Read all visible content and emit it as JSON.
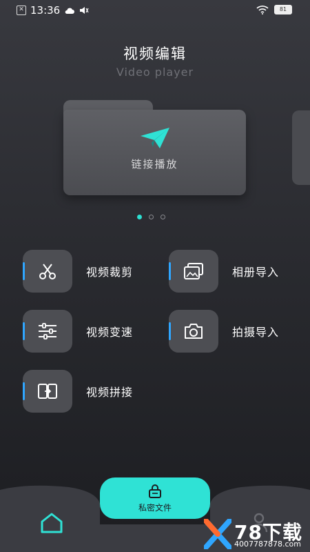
{
  "status_bar": {
    "time": "13:36",
    "battery": "81"
  },
  "header": {
    "title": "视频编辑",
    "subtitle": "Video player"
  },
  "carousel": {
    "card_label": "链接播放",
    "page_count": 3,
    "active_page": 1
  },
  "features": [
    {
      "label": "视频裁剪",
      "icon": "scissors-icon"
    },
    {
      "label": "相册导入",
      "icon": "gallery-icon"
    },
    {
      "label": "视频变速",
      "icon": "sliders-icon"
    },
    {
      "label": "拍摄导入",
      "icon": "camera-icon"
    },
    {
      "label": "视频拼接",
      "icon": "merge-icon"
    }
  ],
  "bottom_bar": {
    "private_label": "私密文件"
  },
  "watermark": {
    "brand": "78下载",
    "domain": "4007787878.com"
  },
  "colors": {
    "accent": "#2fe2d5",
    "indicator": "#2fa6ff",
    "background": "#2a2b30",
    "tile": "#4d4e53"
  }
}
